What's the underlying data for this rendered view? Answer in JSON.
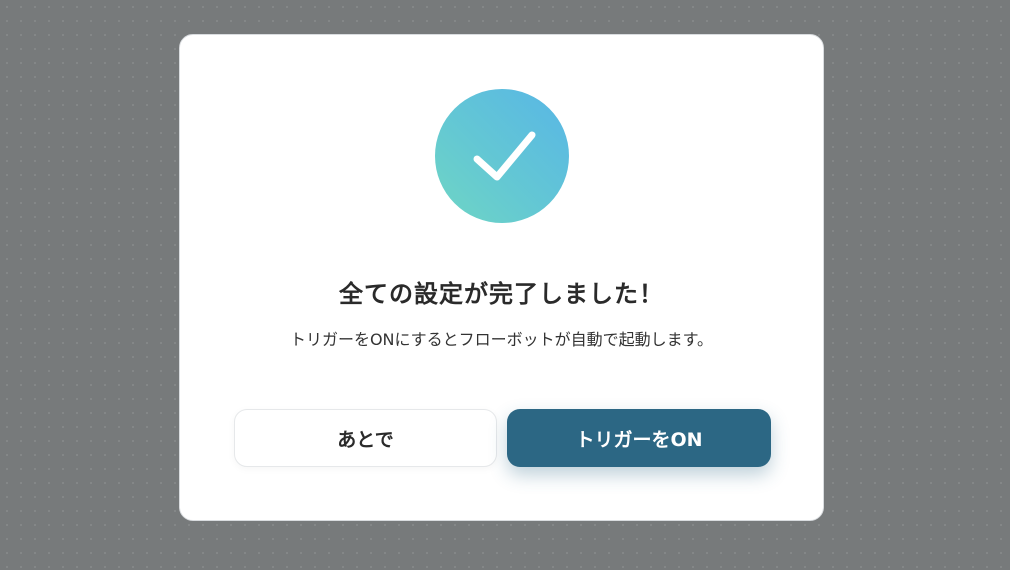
{
  "dialog": {
    "title": "全ての設定が完了しました！",
    "message": "トリガーをONにするとフローボットが自動で起動します。",
    "icon": "check-circle-icon",
    "buttons": {
      "later_label": "あとで",
      "trigger_on_label": "トリガーをON"
    }
  },
  "colors": {
    "overlay": "#777a7b",
    "modal_background": "#ffffff",
    "primary_button": "#2c6784",
    "check_gradient_start": "#6fd6c4",
    "check_gradient_end": "#58b6e6"
  }
}
